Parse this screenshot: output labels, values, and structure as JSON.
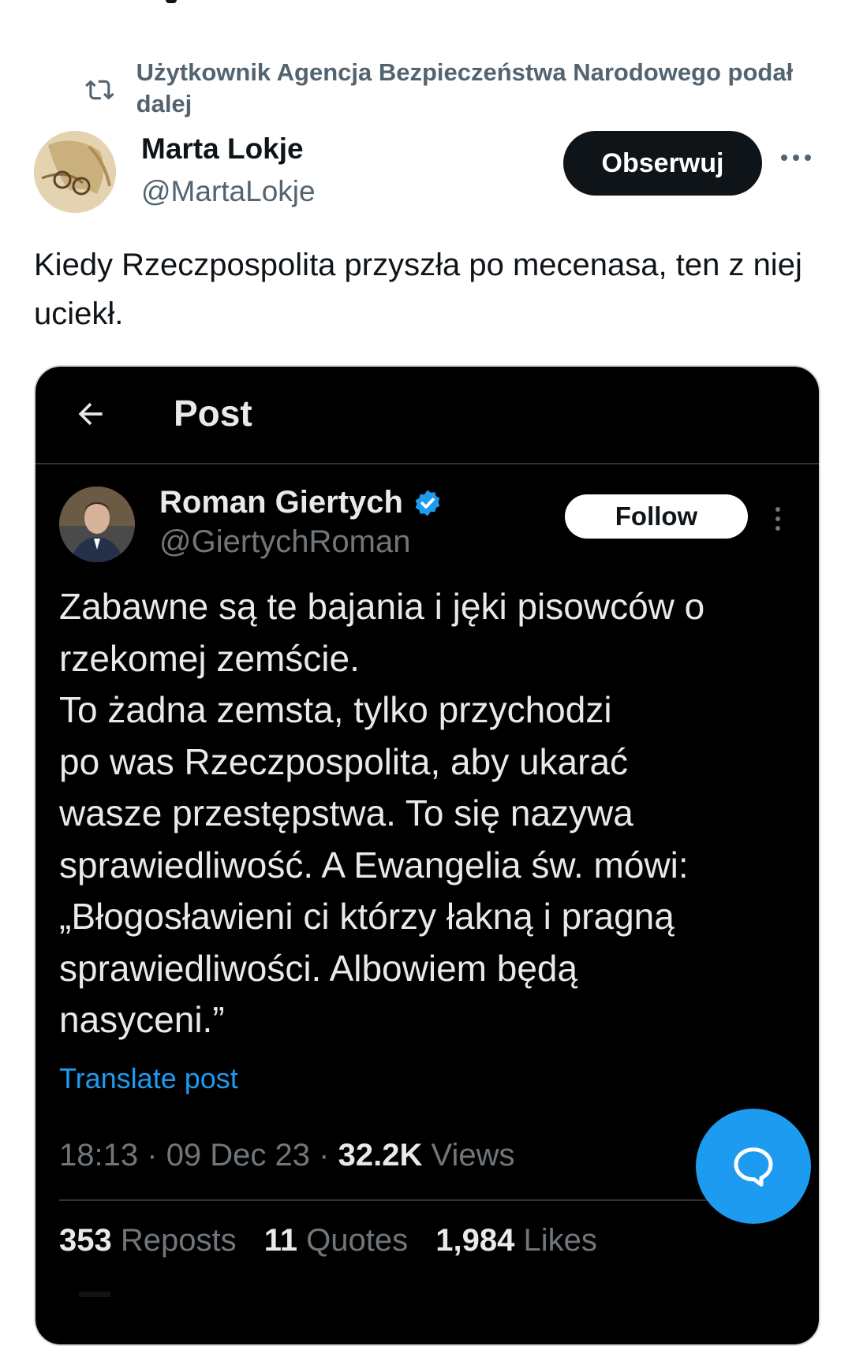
{
  "retweet": {
    "text": "Użytkownik Agencja Bezpieczeństwa Narodowego podał dalej"
  },
  "author": {
    "name": "Marta Lokje",
    "handle": "@MartaLokje",
    "follow_label": "Obserwuj"
  },
  "tweet": {
    "text": "Kiedy Rzeczpospolita przyszła po mecenasa, ten z niej uciekł."
  },
  "embed": {
    "header_title": "Post",
    "author": {
      "name": "Roman Giertych",
      "handle": "@GiertychRoman",
      "follow_label": "Follow"
    },
    "text_lines": [
      "Zabawne są te bajania i jęki pisowców o",
      "rzekomej zemście.",
      "To żadna zemsta, tylko przychodzi",
      "po was Rzeczpospolita, aby ukarać",
      "wasze przestępstwa. To się nazywa",
      "sprawiedliwość. A Ewangelia św. mówi:",
      "„Błogosławieni ci którzy łakną i pragną",
      "sprawiedliwości. Albowiem będą",
      "nasyceni.”"
    ],
    "translate_label": "Translate post",
    "meta": {
      "time": "18:13",
      "date": "09 Dec 23",
      "views_count": "32.2K",
      "views_label": "Views"
    },
    "stats": {
      "reposts_count": "353",
      "reposts_label": "Reposts",
      "quotes_count": "11",
      "quotes_label": "Quotes",
      "likes_count": "1,984",
      "likes_label": "Likes"
    }
  },
  "colors": {
    "accent": "#1d9bf0",
    "text_dark": "#0f1419",
    "text_muted": "#536471",
    "embed_bg": "#000000"
  },
  "icons": {
    "retweet": "retweet-icon",
    "more": "more-icon",
    "back": "back-arrow-icon",
    "verified": "verified-icon",
    "compose": "compose-reply-icon"
  }
}
